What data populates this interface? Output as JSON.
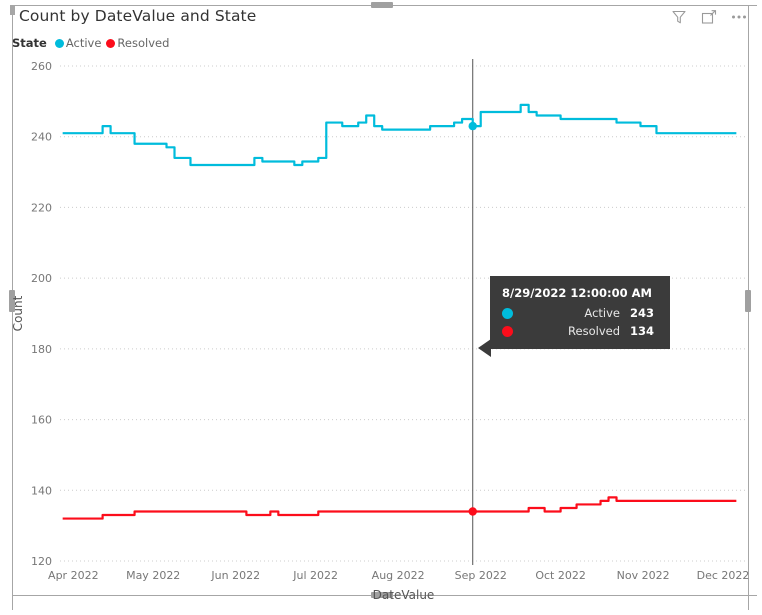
{
  "visual": {
    "title": "Count by DateValue and State",
    "header_icons": [
      {
        "name": "filter-icon",
        "label": "Filters"
      },
      {
        "name": "focus-mode-icon",
        "label": "Focus mode"
      },
      {
        "name": "more-options-icon",
        "label": "More options"
      }
    ]
  },
  "legend": {
    "title": "State",
    "items": [
      {
        "label": "Active",
        "color": "#00BCDC"
      },
      {
        "label": "Resolved",
        "color": "#FC0D1B"
      }
    ]
  },
  "tooltip": {
    "header": "8/29/2022 12:00:00 AM",
    "rows": [
      {
        "label": "Active",
        "value": "243",
        "color": "#00BCDC"
      },
      {
        "label": "Resolved",
        "value": "134",
        "color": "#FC0D1B"
      }
    ]
  },
  "chart_data": {
    "type": "line",
    "title": "Count by DateValue and State",
    "xlabel": "DateValue",
    "ylabel": "Count",
    "ylim": [
      120,
      260
    ],
    "yticks": [
      120,
      140,
      160,
      180,
      200,
      220,
      240,
      260
    ],
    "xtick_labels": [
      "Apr 2022",
      "May 2022",
      "Jun 2022",
      "Jul 2022",
      "Aug 2022",
      "Sep 2022",
      "Oct 2022",
      "Nov 2022",
      "Dec 2022"
    ],
    "xtick_values": [
      "2022-04-01",
      "2022-05-01",
      "2022-06-01",
      "2022-07-01",
      "2022-08-01",
      "2022-09-01",
      "2022-10-01",
      "2022-11-01",
      "2022-12-01"
    ],
    "xlim": [
      "2022-03-27",
      "2022-12-10"
    ],
    "grid": true,
    "grid_axis": "y",
    "legend_position": "top-left",
    "highlight": {
      "x": "2022-08-29",
      "label": "8/29/2022 12:00:00 AM",
      "values": {
        "Active": 243,
        "Resolved": 134
      }
    },
    "x": [
      "2022-03-28",
      "2022-03-31",
      "2022-04-03",
      "2022-04-06",
      "2022-04-09",
      "2022-04-12",
      "2022-04-15",
      "2022-04-18",
      "2022-04-21",
      "2022-04-24",
      "2022-04-27",
      "2022-04-30",
      "2022-05-03",
      "2022-05-06",
      "2022-05-09",
      "2022-05-12",
      "2022-05-15",
      "2022-05-18",
      "2022-05-21",
      "2022-05-24",
      "2022-05-27",
      "2022-05-30",
      "2022-06-02",
      "2022-06-05",
      "2022-06-08",
      "2022-06-11",
      "2022-06-14",
      "2022-06-17",
      "2022-06-20",
      "2022-06-23",
      "2022-06-26",
      "2022-06-29",
      "2022-07-02",
      "2022-07-05",
      "2022-07-08",
      "2022-07-11",
      "2022-07-14",
      "2022-07-17",
      "2022-07-20",
      "2022-07-23",
      "2022-07-26",
      "2022-07-29",
      "2022-08-01",
      "2022-08-04",
      "2022-08-07",
      "2022-08-10",
      "2022-08-13",
      "2022-08-16",
      "2022-08-19",
      "2022-08-22",
      "2022-08-25",
      "2022-08-29",
      "2022-09-01",
      "2022-09-04",
      "2022-09-07",
      "2022-09-10",
      "2022-09-13",
      "2022-09-16",
      "2022-09-19",
      "2022-09-22",
      "2022-09-25",
      "2022-09-28",
      "2022-10-01",
      "2022-10-04",
      "2022-10-07",
      "2022-10-10",
      "2022-10-13",
      "2022-10-16",
      "2022-10-19",
      "2022-10-22",
      "2022-10-25",
      "2022-10-28",
      "2022-10-31",
      "2022-11-03",
      "2022-11-06",
      "2022-11-09",
      "2022-11-12",
      "2022-11-15",
      "2022-11-18",
      "2022-11-21",
      "2022-11-24",
      "2022-11-27",
      "2022-11-30",
      "2022-12-03",
      "2022-12-06"
    ],
    "series": [
      {
        "name": "Active",
        "color": "#00BCDC",
        "values": [
          241,
          241,
          241,
          241,
          241,
          243,
          241,
          241,
          241,
          238,
          238,
          238,
          238,
          237,
          234,
          234,
          232,
          232,
          232,
          232,
          232,
          232,
          232,
          232,
          234,
          233,
          233,
          233,
          233,
          232,
          233,
          233,
          234,
          244,
          244,
          243,
          243,
          244,
          246,
          243,
          242,
          242,
          242,
          242,
          242,
          242,
          243,
          243,
          243,
          244,
          245,
          243,
          247,
          247,
          247,
          247,
          247,
          249,
          247,
          246,
          246,
          246,
          245,
          245,
          245,
          245,
          245,
          245,
          245,
          244,
          244,
          244,
          243,
          243,
          241,
          241,
          241,
          241,
          241,
          241,
          241,
          241,
          241,
          241,
          241
        ]
      },
      {
        "name": "Resolved",
        "color": "#FC0D1B",
        "values": [
          132,
          132,
          132,
          132,
          132,
          133,
          133,
          133,
          133,
          134,
          134,
          134,
          134,
          134,
          134,
          134,
          134,
          134,
          134,
          134,
          134,
          134,
          134,
          133,
          133,
          133,
          134,
          133,
          133,
          133,
          133,
          133,
          134,
          134,
          134,
          134,
          134,
          134,
          134,
          134,
          134,
          134,
          134,
          134,
          134,
          134,
          134,
          134,
          134,
          134,
          134,
          134,
          134,
          134,
          134,
          134,
          134,
          134,
          135,
          135,
          134,
          134,
          135,
          135,
          136,
          136,
          136,
          137,
          138,
          137,
          137,
          137,
          137,
          137,
          137,
          137,
          137,
          137,
          137,
          137,
          137,
          137,
          137,
          137,
          137
        ]
      }
    ]
  }
}
